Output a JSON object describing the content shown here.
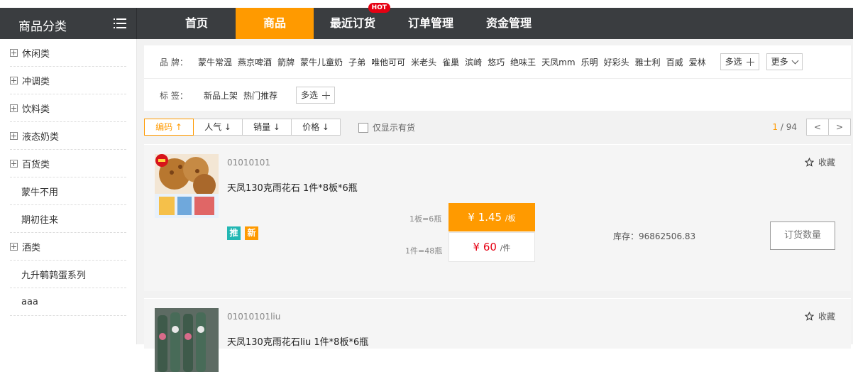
{
  "category_header": {
    "title": "商品分类"
  },
  "nav": {
    "items": [
      {
        "label": "首页"
      },
      {
        "label": "商品"
      },
      {
        "label": "最近订货",
        "badge": "HOT"
      },
      {
        "label": "订单管理"
      },
      {
        "label": "资金管理"
      }
    ]
  },
  "sidebar": {
    "items": [
      {
        "label": "休闲类"
      },
      {
        "label": "冲调类"
      },
      {
        "label": "饮料类"
      },
      {
        "label": "液态奶类"
      },
      {
        "label": "百货类"
      },
      {
        "label": "蒙牛不用"
      },
      {
        "label": "期初往来"
      },
      {
        "label": "酒类"
      },
      {
        "label": "九升鹌鹑蛋系列"
      },
      {
        "label": "aaa"
      }
    ]
  },
  "filter": {
    "brand_label": "品  牌：",
    "brands": [
      "蒙牛常温",
      "燕京啤酒",
      "箭牌",
      "蒙牛儿童奶",
      "子弟",
      "唯他可可",
      "米老头",
      "雀巢",
      "滨崎",
      "悠巧",
      "绝味王",
      "天凤mm",
      "乐明",
      "好彩头",
      "雅士利",
      "百威",
      "爱林"
    ],
    "multi_label": "多选",
    "more_label": "更多",
    "tag_label": "标  签：",
    "tags": [
      "新品上架",
      "热门推荐"
    ]
  },
  "sortbar": {
    "sorts": [
      {
        "label": "编码 ↑"
      },
      {
        "label": "人气 ↓"
      },
      {
        "label": "销量 ↓"
      },
      {
        "label": "价格 ↓"
      }
    ],
    "stock_only_label": "仅显示有货",
    "page_current": "1",
    "page_total": "/ 94",
    "prev": "<",
    "next": ">"
  },
  "products": [
    {
      "code": "01010101",
      "name": "天凤130克雨花石 1件*8板*6瓶",
      "fav_label": "收藏",
      "tag_recommend": "推",
      "tag_new": "新",
      "unit_small": "1板=6瓶",
      "unit_big": "1件=48瓶",
      "price_small": "¥ 1.45",
      "price_small_unit": "/板",
      "price_big": "¥ 60",
      "price_big_unit": "/件",
      "stock": "库存：96862506.83",
      "order_label": "订货数量"
    },
    {
      "code": "01010101liu",
      "name": "天凤130克雨花石liu 1件*8板*6瓶",
      "fav_label": "收藏"
    }
  ],
  "colors": {
    "accent": "#ff9a00",
    "header": "#3a3d40",
    "price": "#e60012",
    "hot": "#e60012"
  }
}
